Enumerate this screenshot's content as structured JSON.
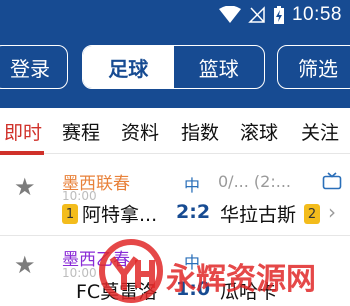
{
  "status_bar": {
    "time": "10:58"
  },
  "header": {
    "login_label": "登录",
    "seg_football": "足球",
    "seg_basketball": "篮球",
    "filter_label": "筛选"
  },
  "tabs": [
    "即时",
    "赛程",
    "资料",
    "指数",
    "滚球",
    "关注"
  ],
  "matches": [
    {
      "league": "墨西联春",
      "league_color": "#e8823b",
      "kick_time": "10:00",
      "half": "中",
      "odds": "0/... (2:...",
      "home_rank": "1",
      "home": "阿特拿...",
      "score": "2:2",
      "away": "华拉古斯",
      "away_rank": "2"
    },
    {
      "league": "墨西乙春",
      "league_color": "#8a2bd6",
      "kick_time": "10:00",
      "half": "中",
      "odds": "",
      "home_rank": "",
      "home": "FC莫雷洛",
      "score": "1:0",
      "away": "瓜哈卡",
      "away_rank": ""
    }
  ],
  "watermark": {
    "text": "永辉资源网",
    "url": ""
  }
}
